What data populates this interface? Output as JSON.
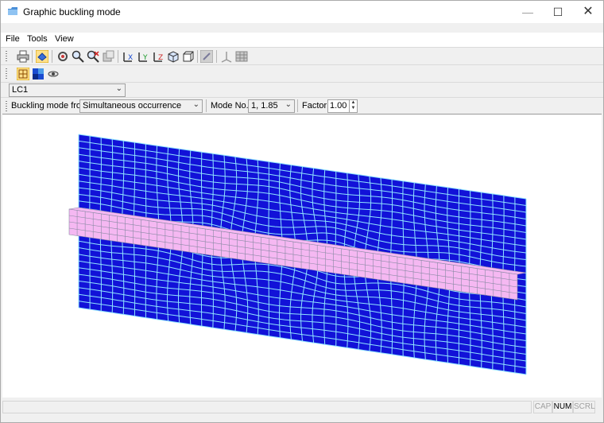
{
  "window": {
    "title": "Graphic buckling mode"
  },
  "window_controls": {
    "minimize": "—",
    "maximize": "☐",
    "close": "✕"
  },
  "menu": [
    "File",
    "Tools",
    "View"
  ],
  "toolbar": {
    "icons": [
      "print-icon",
      "view-mode-icon",
      "settings-icon",
      "zoom-icon",
      "zoom-reset-icon",
      "export-icon",
      "view-x-icon",
      "view-y-icon",
      "view-z-icon",
      "isometric-icon",
      "box-view-icon",
      "render-icon",
      "axes-icon",
      "table-icon"
    ]
  },
  "toolbar2": {
    "icons": [
      "mesh-icon",
      "solid-color-icon",
      "display-icon"
    ]
  },
  "load_case": {
    "value": "LC1"
  },
  "buckling": {
    "label": "Buckling mode from:",
    "value": "Simultaneous occurrence",
    "mode_label": "Mode No.:",
    "mode_value": "1, 1.85",
    "factor_label": "Factor:",
    "factor_value": "1.00"
  },
  "status": {
    "cap": "CAP",
    "num": "NUM",
    "scrl": "SCRL"
  },
  "colors": {
    "plate": "#1212d8",
    "mesh": "#8fe4ff",
    "beam": "#f5b8f2",
    "beam_grid": "#8a8aa4"
  }
}
